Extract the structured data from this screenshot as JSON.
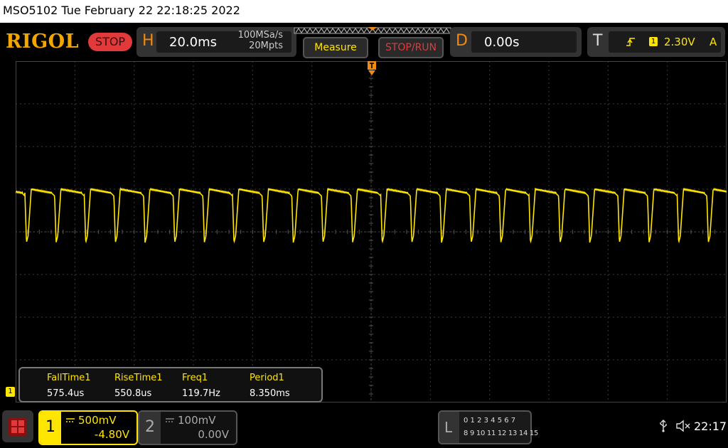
{
  "titlebar": {
    "text": "MSO5102  Tue February 22 22:18:25 2022"
  },
  "brand": {
    "logo": "RIGOL",
    "run_state": "STOP"
  },
  "horizontal": {
    "letter": "H",
    "timebase": "20.0ms",
    "sample_rate": "100MSa/s",
    "mem_depth": "20Mpts"
  },
  "buttons": {
    "measure": "Measure",
    "stop_run": "STOP/RUN"
  },
  "delay": {
    "letter": "D",
    "value": "0.00s"
  },
  "trigger": {
    "letter": "T",
    "channel_badge": "1",
    "level": "2.30V",
    "mode": "A"
  },
  "marker": {
    "ch1_ground": "1"
  },
  "measurements": [
    {
      "label": "FallTime1",
      "value": "575.4us"
    },
    {
      "label": "RiseTime1",
      "value": "550.8us"
    },
    {
      "label": "Freq1",
      "value": "119.7Hz"
    },
    {
      "label": "Period1",
      "value": "8.350ms"
    }
  ],
  "channels": [
    {
      "number": "1",
      "scale": "500mV",
      "offset": "-4.80V",
      "coupling_icon": "dc-coupling-icon"
    },
    {
      "number": "2",
      "scale": "100mV",
      "offset": "0.00V",
      "coupling_icon": "dc-coupling-icon"
    }
  ],
  "logic": {
    "letter": "L",
    "row1": "0 1 2 3  4 5 6 7",
    "row2": "8 9 10 11 12 13 14 15"
  },
  "status": {
    "time": "22:17"
  },
  "colors": {
    "ch1": "#ffe600",
    "accent": "#f08a10",
    "stop_red": "#e23a3a",
    "grid": "#3a3a3a"
  }
}
